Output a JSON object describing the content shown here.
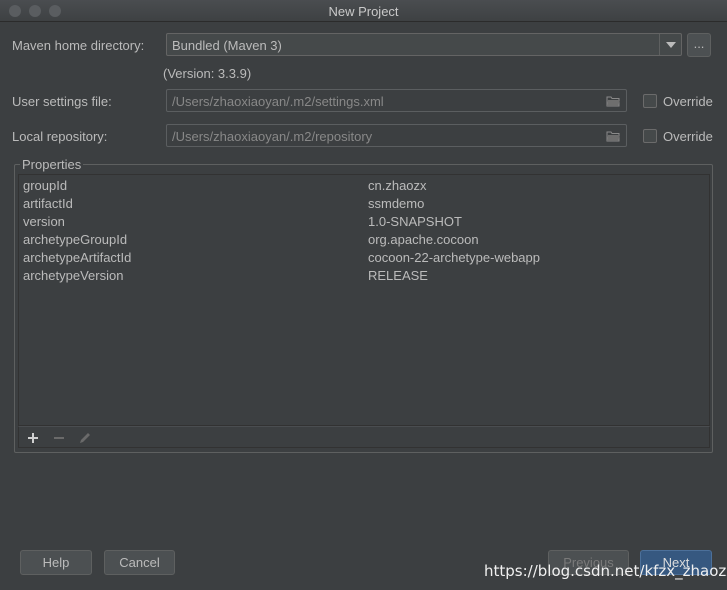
{
  "window": {
    "title": "New Project"
  },
  "maven": {
    "home_label": "Maven home directory:",
    "home_value": "Bundled (Maven 3)",
    "browse_label": "...",
    "version_text": "(Version: 3.3.9)"
  },
  "user_settings": {
    "label": "User settings file:",
    "value": "/Users/zhaoxiaoyan/.m2/settings.xml",
    "override_label": "Override"
  },
  "local_repo": {
    "label": "Local repository:",
    "value": "/Users/zhaoxiaoyan/.m2/repository",
    "override_label": "Override"
  },
  "properties": {
    "title": "Properties",
    "rows": [
      {
        "key": "groupId",
        "value": "cn.zhaozx"
      },
      {
        "key": "artifactId",
        "value": "ssmdemo"
      },
      {
        "key": "version",
        "value": "1.0-SNAPSHOT"
      },
      {
        "key": "archetypeGroupId",
        "value": "org.apache.cocoon"
      },
      {
        "key": "archetypeArtifactId",
        "value": "cocoon-22-archetype-webapp"
      },
      {
        "key": "archetypeVersion",
        "value": "RELEASE"
      }
    ],
    "toolbar": {
      "add_icon": "plus-icon",
      "remove_icon": "minus-icon",
      "edit_icon": "pencil-icon"
    }
  },
  "buttons": {
    "help": "Help",
    "cancel": "Cancel",
    "previous": "Previous",
    "next": "Next"
  },
  "watermark": "https://blog.csdn.net/kfzx_zhaozx",
  "colors": {
    "background": "#3c3f41",
    "primary_button": "#365880",
    "text": "#bbbbbb"
  }
}
